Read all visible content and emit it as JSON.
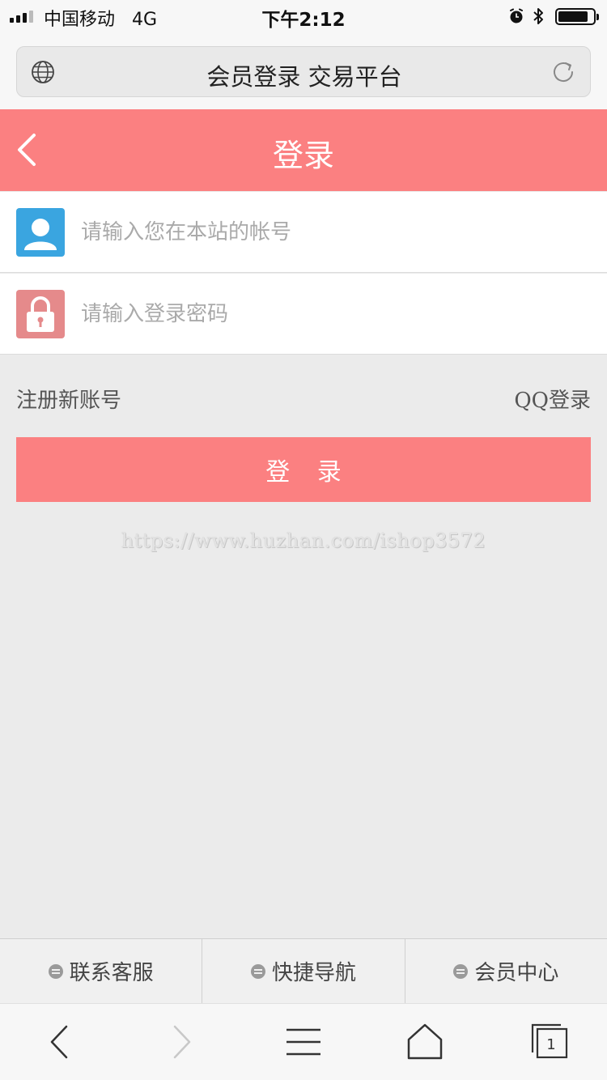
{
  "status_bar": {
    "carrier": "中国移动",
    "network": "4G",
    "time": "下午2:12"
  },
  "browser": {
    "page_title": "会员登录 交易平台",
    "tab_count": "1"
  },
  "header": {
    "title": "登录"
  },
  "form": {
    "username_placeholder": "请输入您在本站的帐号",
    "password_placeholder": "请输入登录密码",
    "register_label": "注册新账号",
    "qq_login_label": "QQ登录",
    "login_button_label": "登 录"
  },
  "watermark": "https://www.huzhan.com/ishop3572",
  "bottom_nav": {
    "items": [
      {
        "label": "联系客服"
      },
      {
        "label": "快捷导航"
      },
      {
        "label": "会员中心"
      }
    ]
  },
  "colors": {
    "accent": "#fb8081",
    "user_icon": "#3aa5e0",
    "lock_icon": "#e58a8b",
    "page_background": "#ebebeb"
  }
}
